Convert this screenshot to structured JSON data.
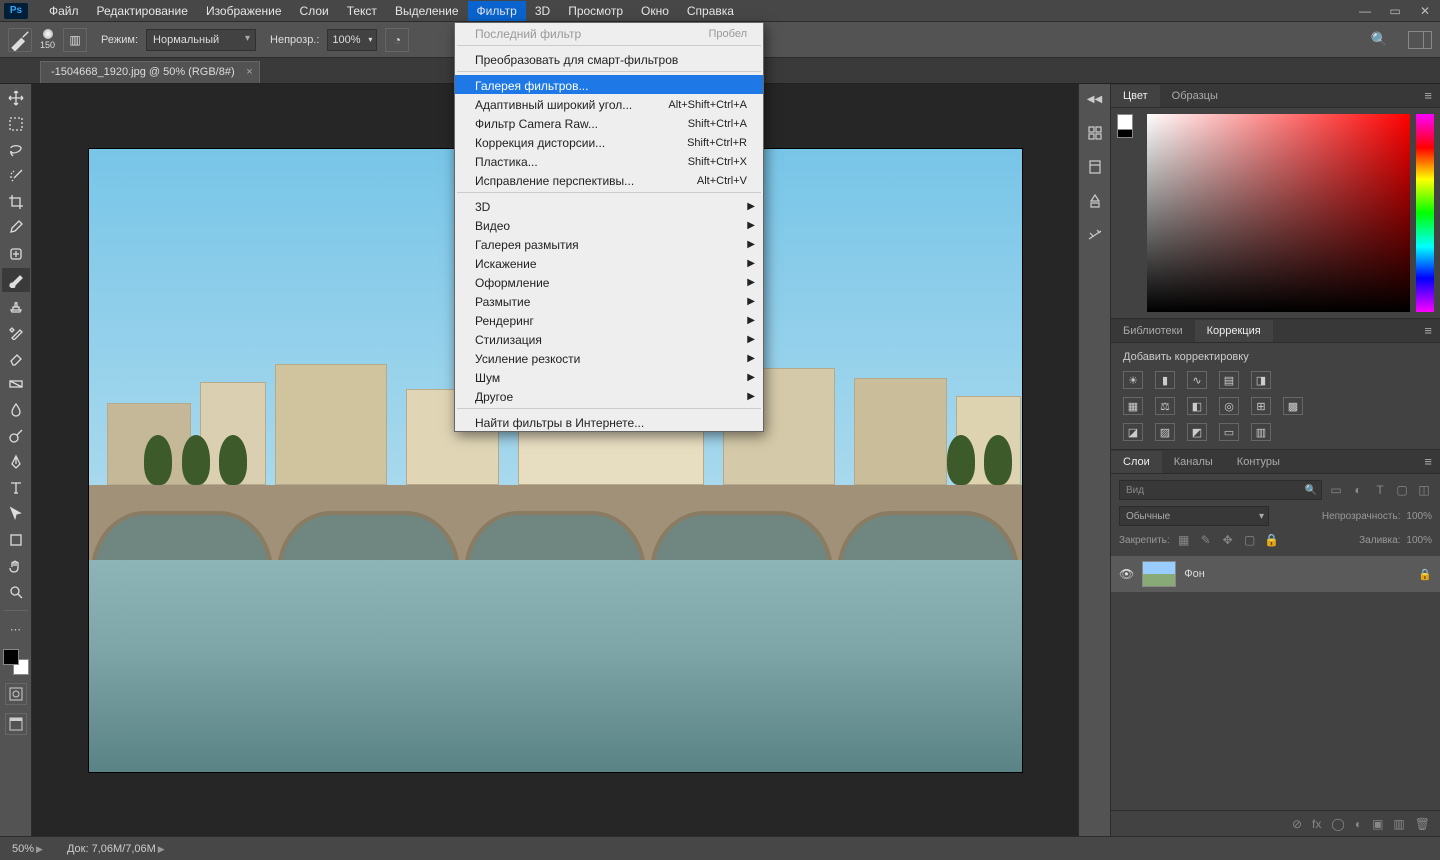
{
  "app": {
    "logo": "Ps"
  },
  "menubar": {
    "items": [
      "Файл",
      "Редактирование",
      "Изображение",
      "Слои",
      "Текст",
      "Выделение",
      "Фильтр",
      "3D",
      "Просмотр",
      "Окно",
      "Справка"
    ],
    "open_index": 6
  },
  "optionsbar": {
    "brush_size": "150",
    "mode_label": "Режим:",
    "mode_value": "Нормальный",
    "opacity_label": "Непрозр.:",
    "opacity_value": "100%"
  },
  "document_tab": {
    "title": "-1504668_1920.jpg @ 50% (RGB/8#)"
  },
  "dropdown": {
    "items": [
      {
        "label": "Последний фильтр",
        "shortcut": "Пробел",
        "disabled": true
      },
      {
        "sep": true
      },
      {
        "label": "Преобразовать для смарт-фильтров"
      },
      {
        "sep": true
      },
      {
        "label": "Галерея фильтров...",
        "highlight": true
      },
      {
        "label": "Адаптивный широкий угол...",
        "shortcut": "Alt+Shift+Ctrl+A"
      },
      {
        "label": "Фильтр Camera Raw...",
        "shortcut": "Shift+Ctrl+A"
      },
      {
        "label": "Коррекция дисторсии...",
        "shortcut": "Shift+Ctrl+R"
      },
      {
        "label": "Пластика...",
        "shortcut": "Shift+Ctrl+X"
      },
      {
        "label": "Исправление перспективы...",
        "shortcut": "Alt+Ctrl+V"
      },
      {
        "sep": true
      },
      {
        "label": "3D",
        "submenu": true
      },
      {
        "label": "Видео",
        "submenu": true
      },
      {
        "label": "Галерея размытия",
        "submenu": true
      },
      {
        "label": "Искажение",
        "submenu": true
      },
      {
        "label": "Оформление",
        "submenu": true
      },
      {
        "label": "Размытие",
        "submenu": true
      },
      {
        "label": "Рендеринг",
        "submenu": true
      },
      {
        "label": "Стилизация",
        "submenu": true
      },
      {
        "label": "Усиление резкости",
        "submenu": true
      },
      {
        "label": "Шум",
        "submenu": true
      },
      {
        "label": "Другое",
        "submenu": true
      },
      {
        "sep": true
      },
      {
        "label": "Найти фильтры в Интернете..."
      }
    ]
  },
  "panels": {
    "color": {
      "tabs": [
        "Цвет",
        "Образцы"
      ],
      "active": 0
    },
    "libraries": {
      "tabs": [
        "Библиотеки",
        "Коррекция"
      ],
      "active": 1,
      "heading": "Добавить корректировку"
    },
    "layers": {
      "tabs": [
        "Слои",
        "Каналы",
        "Контуры"
      ],
      "active": 0,
      "search_placeholder": "Вид",
      "blend_mode": "Обычные",
      "opacity_label": "Непрозрачность:",
      "opacity_value": "100%",
      "lock_label": "Закрепить:",
      "fill_label": "Заливка:",
      "fill_value": "100%",
      "layer_name": "Фон"
    }
  },
  "statusbar": {
    "zoom": "50%",
    "doc_info": "Док: 7,06M/7,06M"
  }
}
